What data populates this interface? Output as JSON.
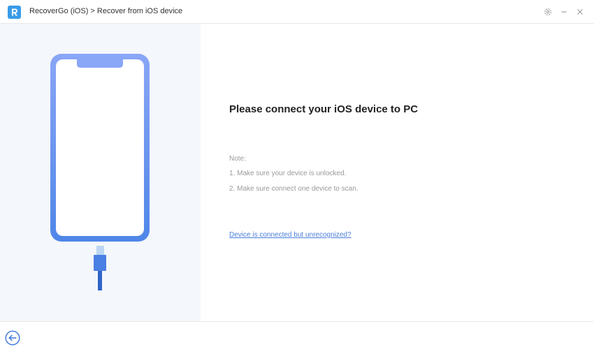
{
  "window": {
    "title": "RecoverGo (iOS) > Recover from iOS device",
    "logo_letter": "R"
  },
  "main": {
    "heading": "Please connect your iOS device to PC",
    "note_label": "Note:",
    "notes": [
      "1. Make sure your device is unlocked.",
      "2. Make sure connect one device to scan."
    ],
    "help_link": "Device is connected but unrecognized?"
  },
  "icons": {
    "settings": "gear-icon",
    "minimize": "minimize-icon",
    "close": "close-icon",
    "back": "back-arrow-icon"
  },
  "colors": {
    "accent": "#4a7fd9",
    "phone_gradient_top": "#8aa6f7",
    "phone_gradient_bottom": "#4f86e8",
    "left_panel_bg": "#f4f7fb"
  }
}
